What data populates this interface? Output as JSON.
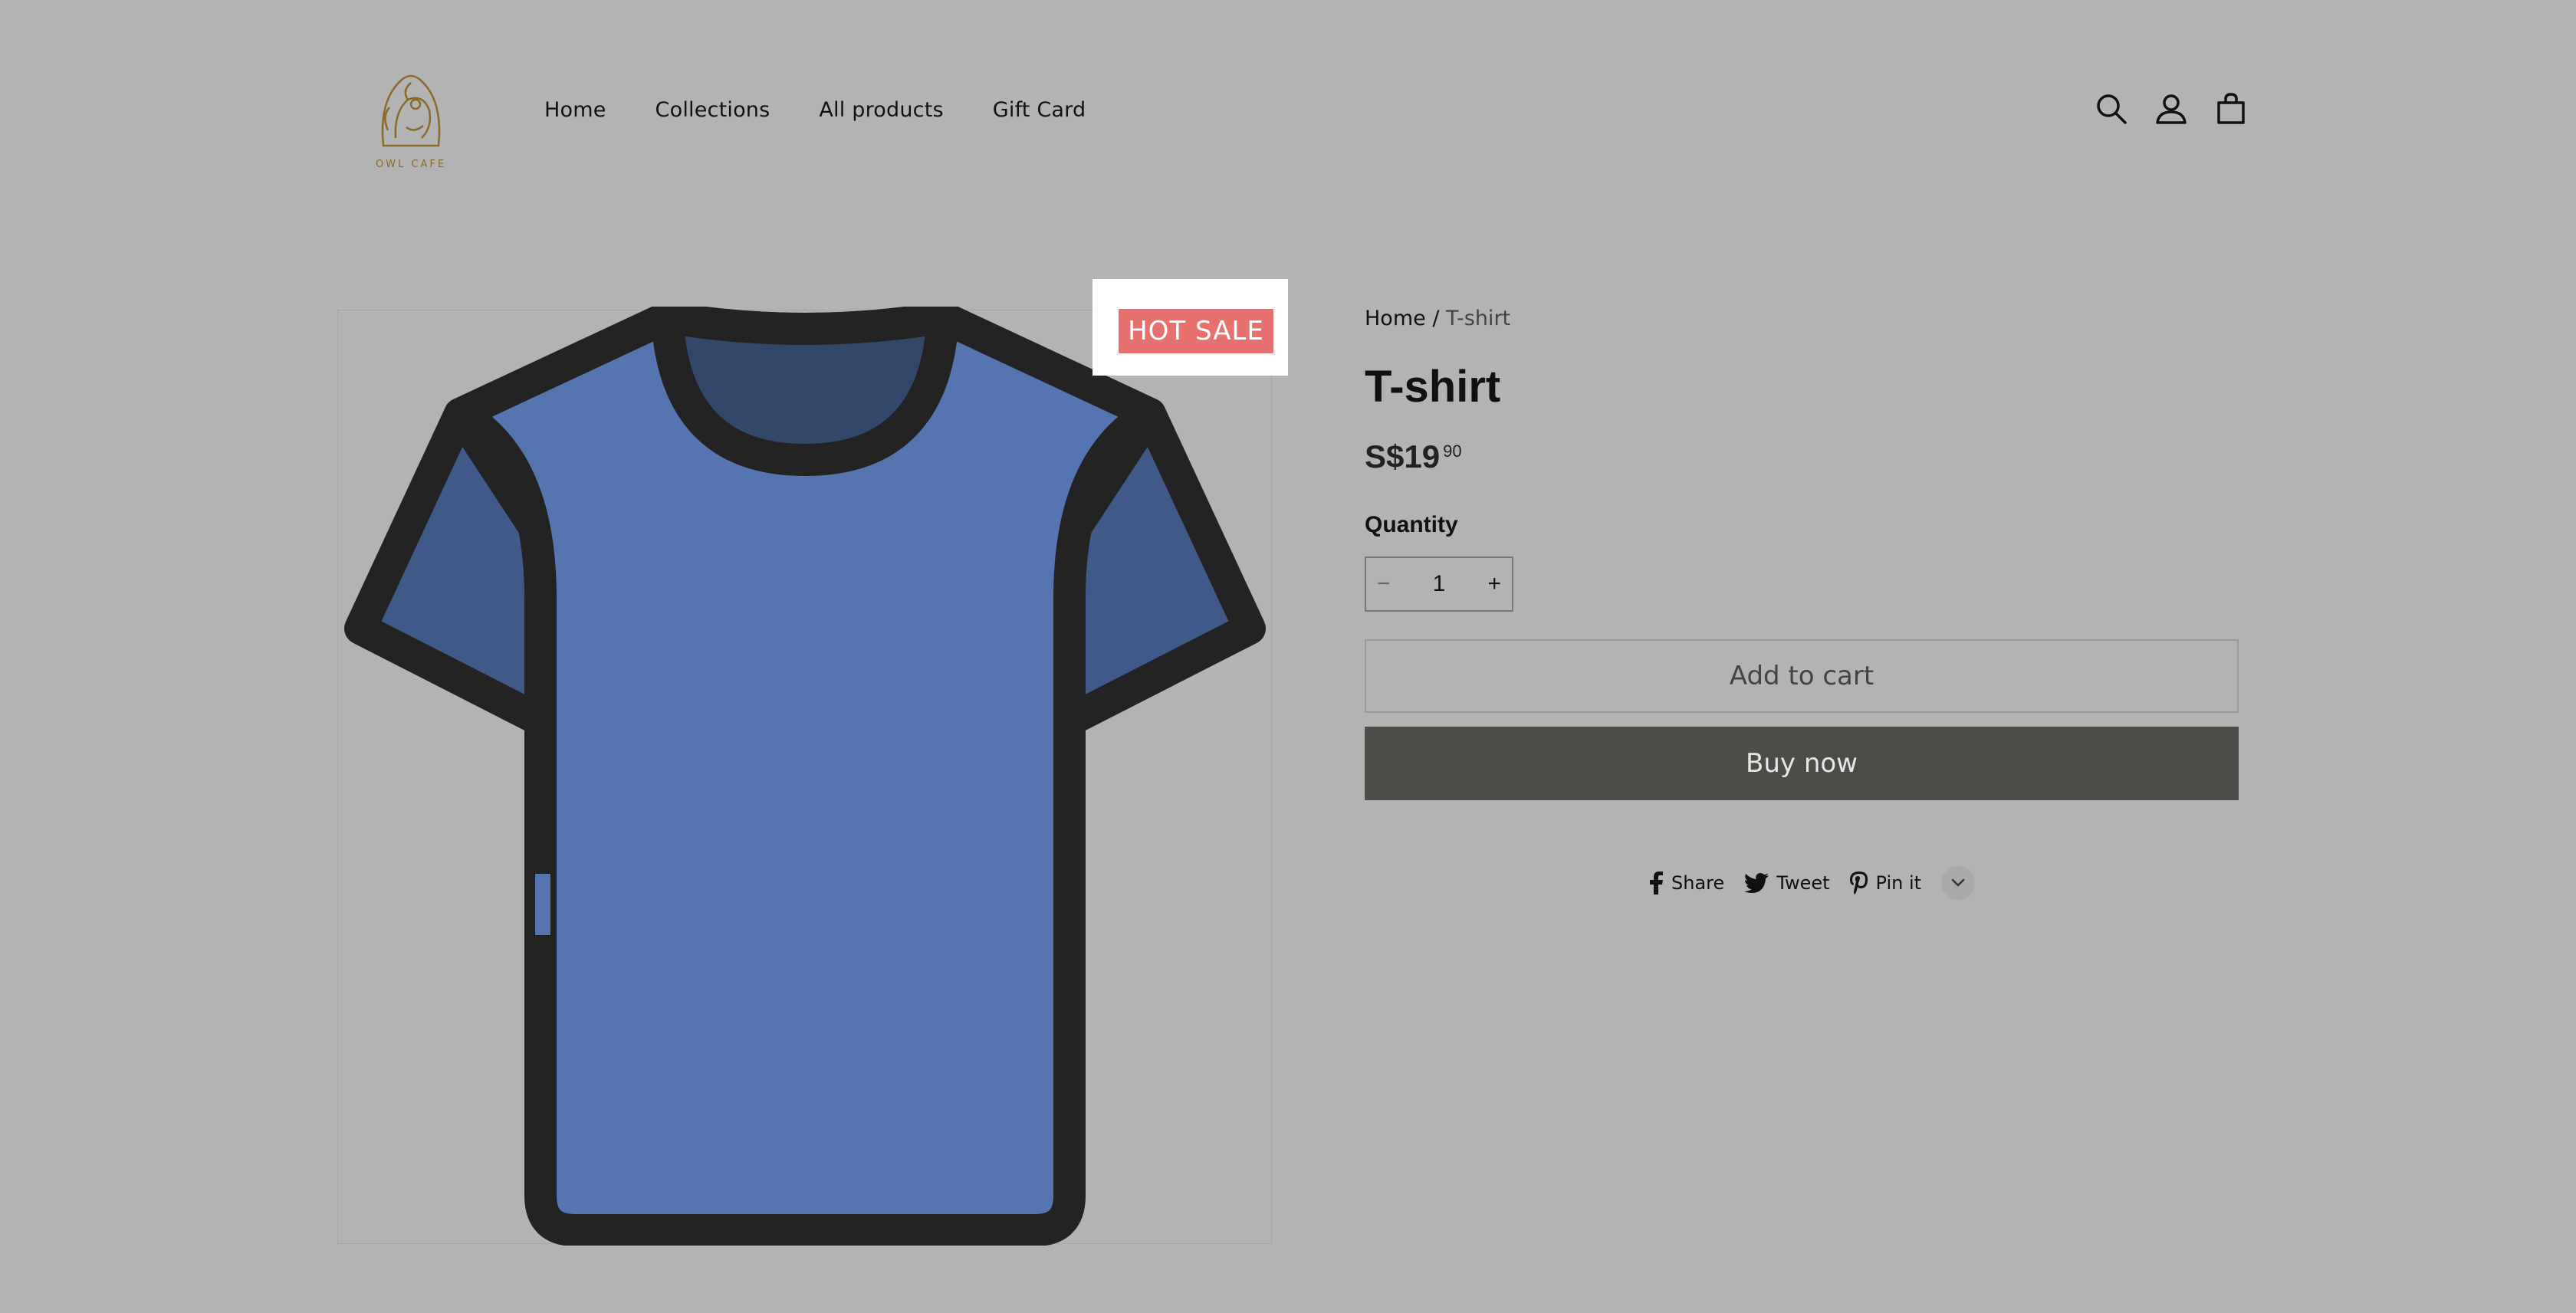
{
  "brand": {
    "logo_text": "OWL CAFE"
  },
  "nav": {
    "items": [
      "Home",
      "Collections",
      "All products",
      "Gift Card"
    ]
  },
  "header_icons": [
    "search-icon",
    "account-icon",
    "cart-icon"
  ],
  "product": {
    "badge": "HOT SALE",
    "breadcrumb": {
      "home": "Home",
      "separator": " / ",
      "current": "T-shirt"
    },
    "title": "T-shirt",
    "price": {
      "main": "S$19",
      "cents": "90"
    },
    "quantity_label": "Quantity",
    "quantity": {
      "minus": "−",
      "value": "1",
      "plus": "+"
    },
    "add_to_cart": "Add to cart",
    "buy_now": "Buy now"
  },
  "share": {
    "facebook": "Share",
    "twitter": "Tweet",
    "pinterest": "Pin it"
  },
  "colors": {
    "background": "#b3b3b3",
    "badge": "#e8706e",
    "buy_now": "#4d4c48",
    "logo": "#8a6a2a",
    "shirt": "#5575b0"
  }
}
